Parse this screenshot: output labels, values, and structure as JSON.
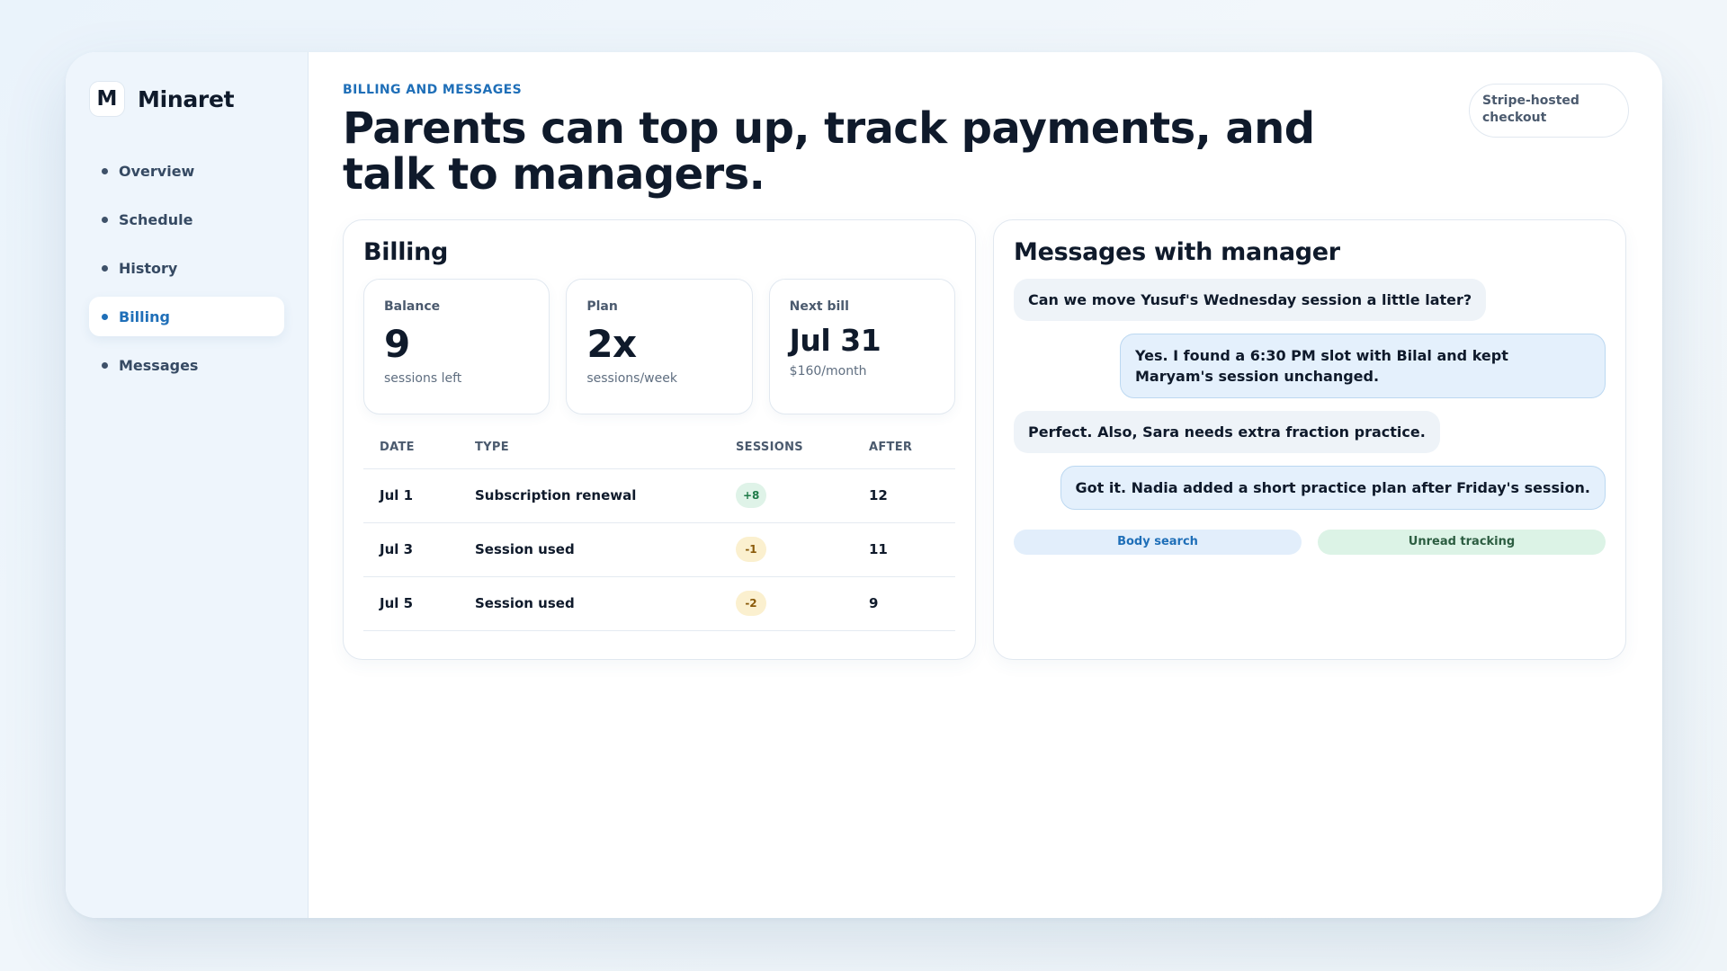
{
  "brand": {
    "mark": "M",
    "name": "Minaret"
  },
  "nav": [
    {
      "label": "Overview",
      "active": false
    },
    {
      "label": "Schedule",
      "active": false
    },
    {
      "label": "History",
      "active": false
    },
    {
      "label": "Billing",
      "active": true
    },
    {
      "label": "Messages",
      "active": false
    }
  ],
  "header": {
    "eyebrow": "BILLING AND MESSAGES",
    "headline": "Parents can top up, track payments, and talk to managers.",
    "badge": "Stripe-hosted checkout"
  },
  "billing": {
    "title": "Billing",
    "stats": [
      {
        "label": "Balance",
        "value": "9",
        "sub": "sessions left"
      },
      {
        "label": "Plan",
        "value": "2x",
        "sub": "sessions/week"
      },
      {
        "label": "Next bill",
        "value": "Jul 31",
        "sub": "$160/month"
      }
    ],
    "columns": [
      "DATE",
      "TYPE",
      "SESSIONS",
      "AFTER"
    ],
    "rows": [
      {
        "date": "Jul 1",
        "type": "Subscription renewal",
        "sessions": "+8",
        "after": "12"
      },
      {
        "date": "Jul 3",
        "type": "Session used",
        "sessions": "-1",
        "after": "11"
      },
      {
        "date": "Jul 5",
        "type": "Session used",
        "sessions": "-2",
        "after": "9"
      }
    ]
  },
  "messages": {
    "title": "Messages with manager",
    "items": [
      {
        "direction": "in",
        "text": "Can we move Yusuf's Wednesday session a little later?"
      },
      {
        "direction": "out",
        "text": "Yes. I found a 6:30 PM slot with Bilal and kept Maryam's session unchanged."
      },
      {
        "direction": "in",
        "text": "Perfect. Also, Sara needs extra fraction practice."
      },
      {
        "direction": "out",
        "text": "Got it. Nadia added a short practice plan after Friday's session."
      }
    ],
    "tags": [
      "Body search",
      "Unread tracking"
    ]
  },
  "colors": {
    "accent": "#1f6fb8",
    "positive_chip": "#dff3e8",
    "negative_chip": "#fbf0cf"
  }
}
